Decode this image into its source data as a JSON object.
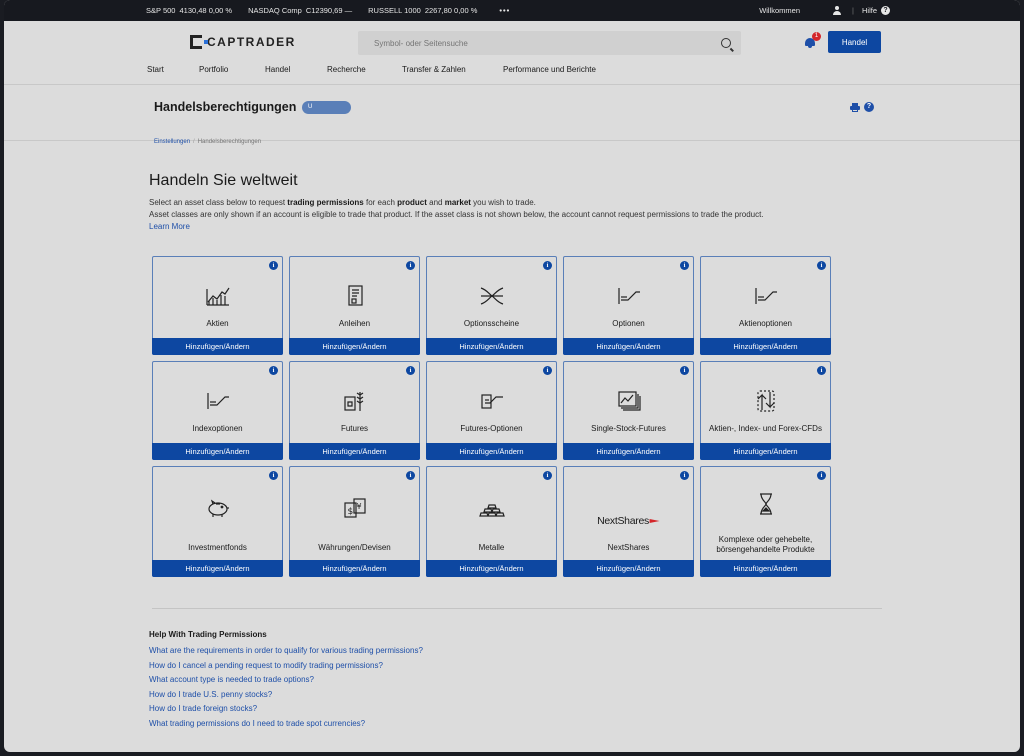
{
  "ticker": {
    "items": [
      {
        "name": "S&P 500",
        "value": "4130,48",
        "change": "0,00 %"
      },
      {
        "name": "NASDAQ Comp",
        "value": "C12390,69",
        "change": "—"
      },
      {
        "name": "RUSSELL 1000",
        "value": "2267,80",
        "change": "0,00 %"
      }
    ],
    "more": "•••",
    "welcome": "Willkommen",
    "separator": "|",
    "help": "Hilfe",
    "help_glyph": "?"
  },
  "header": {
    "brand": "CAPTRADER",
    "search_placeholder": "Symbol- oder Seitensuche",
    "notification_count": "1",
    "trade_button": "Handel",
    "nav": [
      "Start",
      "Portfolio",
      "Handel",
      "Recherche",
      "Transfer & Zahlen",
      "Performance und Berichte"
    ]
  },
  "titlebar": {
    "title": "Handelsberechtigungen",
    "account": "U",
    "help_glyph": "?"
  },
  "breadcrumb": {
    "parent": "Einstellungen",
    "separator": "/",
    "current": "Handelsberechtigungen"
  },
  "intro": {
    "title": "Handeln Sie weltweit",
    "line1_a": "Select an asset class below to request ",
    "line1_b": "trading permissions",
    "line1_c": " for each ",
    "line1_d": "product",
    "line1_e": " and ",
    "line1_f": "market",
    "line1_g": " you wish to trade.",
    "line2": "Asset classes are only shown if an account is eligible to trade that product. If the asset class is not shown below, the account cannot request permissions to trade the product.",
    "learn_more": "Learn More"
  },
  "cards": {
    "info_glyph": "i",
    "action": "Hinzufügen/Ändern",
    "items": [
      {
        "label": "Aktien",
        "icon": "stock-chart-icon"
      },
      {
        "label": "Anleihen",
        "icon": "bond-document-icon"
      },
      {
        "label": "Optionsscheine",
        "icon": "warrant-cross-icon"
      },
      {
        "label": "Optionen",
        "icon": "option-payoff-icon"
      },
      {
        "label": "Aktienoptionen",
        "icon": "option-payoff-icon"
      },
      {
        "label": "Indexoptionen",
        "icon": "option-payoff-icon"
      },
      {
        "label": "Futures",
        "icon": "futures-wheat-icon"
      },
      {
        "label": "Futures-Optionen",
        "icon": "futures-option-icon"
      },
      {
        "label": "Single-Stock-Futures",
        "icon": "stacked-charts-icon"
      },
      {
        "label": "Aktien-, Index- und Forex-CFDs",
        "icon": "exchange-arrows-icon"
      },
      {
        "label": "Investmentfonds",
        "icon": "piggy-bank-icon"
      },
      {
        "label": "Währungen/Devisen",
        "icon": "currency-notes-icon"
      },
      {
        "label": "Metalle",
        "icon": "gold-bars-icon"
      },
      {
        "label": "NextShares",
        "icon": "nextshares-logo"
      },
      {
        "label": "Komplexe oder gehebelte, börsengehandelte Produkte",
        "icon": "hourglass-icon"
      }
    ],
    "nextshares_logo_text": "NextShares"
  },
  "help": {
    "title": "Help With Trading Permissions",
    "links": [
      "What are the requirements in order to qualify for various trading permissions?",
      "How do I cancel a pending request to modify trading permissions?",
      "What account type is needed to trade options?",
      "How do I trade U.S. penny stocks?",
      "How do I trade foreign stocks?",
      "What trading permissions do I need to trade spot currencies?"
    ]
  },
  "colors": {
    "accent": "#0d47a1",
    "link": "#1e4fa8",
    "badge": "#d4262a",
    "background": "#dcdcdc",
    "ticker_bar": "#17191f"
  }
}
